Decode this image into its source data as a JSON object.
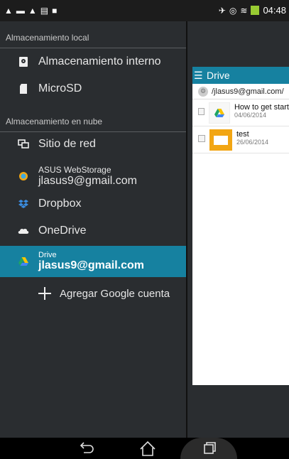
{
  "status_bar": {
    "time": "04:48"
  },
  "drawer": {
    "local_header": "Almacenamiento local",
    "local_items": [
      {
        "label": "Almacenamiento interno"
      },
      {
        "label": "MicroSD"
      }
    ],
    "cloud_header": "Almacenamiento en nube",
    "cloud_items": [
      {
        "label": "Sitio de red"
      },
      {
        "title": "ASUS WebStorage",
        "subtitle": "jlasus9@gmail.com"
      },
      {
        "label": "Dropbox"
      },
      {
        "label": "OneDrive"
      },
      {
        "title": "Drive",
        "subtitle": "jlasus9@gmail.com"
      }
    ],
    "add_account_label": "Agregar Google cuenta"
  },
  "drive_panel": {
    "title": "Drive",
    "path": "/jlasus9@gmail.com/",
    "files": [
      {
        "name": "How to get start",
        "date": "04/06/2014"
      },
      {
        "name": "test",
        "date": "26/06/2014"
      }
    ]
  },
  "colors": {
    "accent": "#1681a0",
    "drawer_bg": "#2a2d30",
    "folder": "#f2a614"
  }
}
